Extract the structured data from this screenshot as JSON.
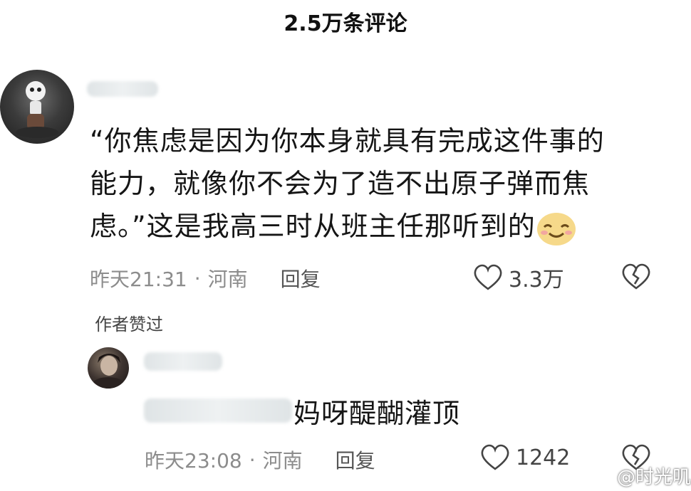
{
  "header": {
    "title": "2.5万条评论"
  },
  "comment": {
    "text_line1": "“你焦虑是因为你本身就具有完成这件事的",
    "text_line2": "能力，就像你不会为了造不出原子弹而焦",
    "text_line3": "虑。”这是我高三时从班主任那听到的",
    "emoji": "smiling-face-icon",
    "time": "昨天21:31",
    "sep": "·",
    "location": "河南",
    "reply_label": "回复",
    "likes": "3.3万",
    "author_liked": "作者赞过"
  },
  "reply": {
    "text": "妈呀醍醐灌顶",
    "time": "昨天23:08",
    "sep": "·",
    "location": "河南",
    "reply_label": "回复",
    "likes": "1242"
  },
  "watermark": {
    "text": "@时光叽"
  }
}
